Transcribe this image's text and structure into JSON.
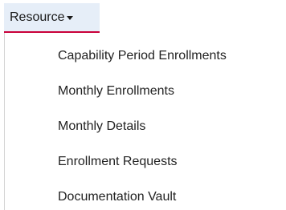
{
  "menu": {
    "label": "Resource",
    "items": [
      {
        "label": "Capability Period Enrollments"
      },
      {
        "label": "Monthly Enrollments"
      },
      {
        "label": "Monthly Details"
      },
      {
        "label": "Enrollment Requests"
      },
      {
        "label": "Documentation Vault"
      }
    ]
  }
}
